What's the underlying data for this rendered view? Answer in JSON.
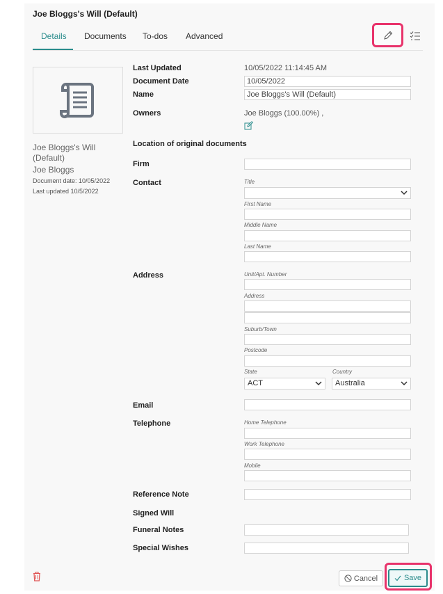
{
  "header": {
    "title": "Joe Bloggs's Will (Default)"
  },
  "tabs": [
    {
      "label": "Details",
      "active": true
    },
    {
      "label": "Documents",
      "active": false
    },
    {
      "label": "To-dos",
      "active": false
    },
    {
      "label": "Advanced",
      "active": false
    }
  ],
  "sidebar": {
    "doc_title": "Joe Bloggs's Will (Default)",
    "owner": "Joe Bloggs",
    "document_date": "Document date: 10/05/2022",
    "last_updated": "Last updated 10/5/2022"
  },
  "details": {
    "last_updated_label": "Last Updated",
    "last_updated_value": "10/05/2022 11:14:45 AM",
    "document_date_label": "Document Date",
    "document_date_value": "10/05/2022",
    "name_label": "Name",
    "name_value": "Joe Bloggs's Will (Default)",
    "owners_label": "Owners",
    "owners_value": "Joe Bloggs (100.00%) ,",
    "location_label": "Location of original documents",
    "firm_label": "Firm",
    "contact_label": "Contact",
    "contact_title_label": "Title",
    "contact_first_label": "First Name",
    "contact_middle_label": "Middle Name",
    "contact_last_label": "Last Name",
    "address_label": "Address",
    "unit_label": "Unit/Apt. Number",
    "address_sub_label": "Address",
    "suburb_label": "Suburb/Town",
    "postcode_label": "Postcode",
    "state_label": "State",
    "state_value": "ACT",
    "country_label": "Country",
    "country_value": "Australia",
    "email_label": "Email",
    "telephone_label": "Telephone",
    "home_tel_label": "Home Telephone",
    "work_tel_label": "Work Telephone",
    "mobile_label": "Mobile",
    "reference_note_label": "Reference Note",
    "signed_will_label": "Signed Will",
    "funeral_notes_label": "Funeral Notes",
    "special_wishes_label": "Special Wishes"
  },
  "footer": {
    "cancel_label": "Cancel",
    "save_label": "Save"
  },
  "colors": {
    "accent": "#2a8c8c",
    "highlight": "#e8336b",
    "delete": "#e05555"
  },
  "icons": [
    "pencil-icon",
    "checklist-icon",
    "scroll-document-icon",
    "edit-icon",
    "chevron-down-icon",
    "trash-icon",
    "cancel-icon",
    "check-icon"
  ]
}
